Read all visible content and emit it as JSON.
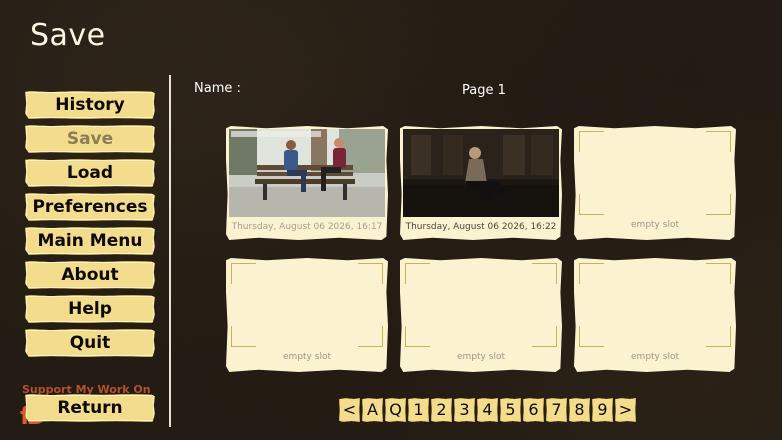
{
  "screen": {
    "title": "Save"
  },
  "nav": {
    "items": [
      {
        "label": "History"
      },
      {
        "label": "Save"
      },
      {
        "label": "Load"
      },
      {
        "label": "Preferences"
      },
      {
        "label": "Main Menu"
      },
      {
        "label": "About"
      },
      {
        "label": "Help"
      },
      {
        "label": "Quit"
      }
    ],
    "active_index": 1,
    "return_label": "Return",
    "support_text": "Support My Work On"
  },
  "header": {
    "name_label": "Name :",
    "page_label": "Page 1"
  },
  "slots": [
    {
      "label": "Thursday, August 06 2026, 16:17",
      "filled": true,
      "thumbnail": "park-bench-scene"
    },
    {
      "label": "Thursday, August 06 2026, 16:22",
      "filled": true,
      "thumbnail": "dark-room-scene"
    },
    {
      "label": "empty slot",
      "filled": false
    },
    {
      "label": "empty slot",
      "filled": false
    },
    {
      "label": "empty slot",
      "filled": false
    },
    {
      "label": "empty slot",
      "filled": false
    }
  ],
  "pager": [
    "<",
    "A",
    "Q",
    "1",
    "2",
    "3",
    "4",
    "5",
    "6",
    "7",
    "8",
    "9",
    ">"
  ],
  "colors": {
    "button": "#f3dd8c",
    "slot": "#fbf3cf",
    "background": "#231c14",
    "accent": "#e0552a"
  }
}
